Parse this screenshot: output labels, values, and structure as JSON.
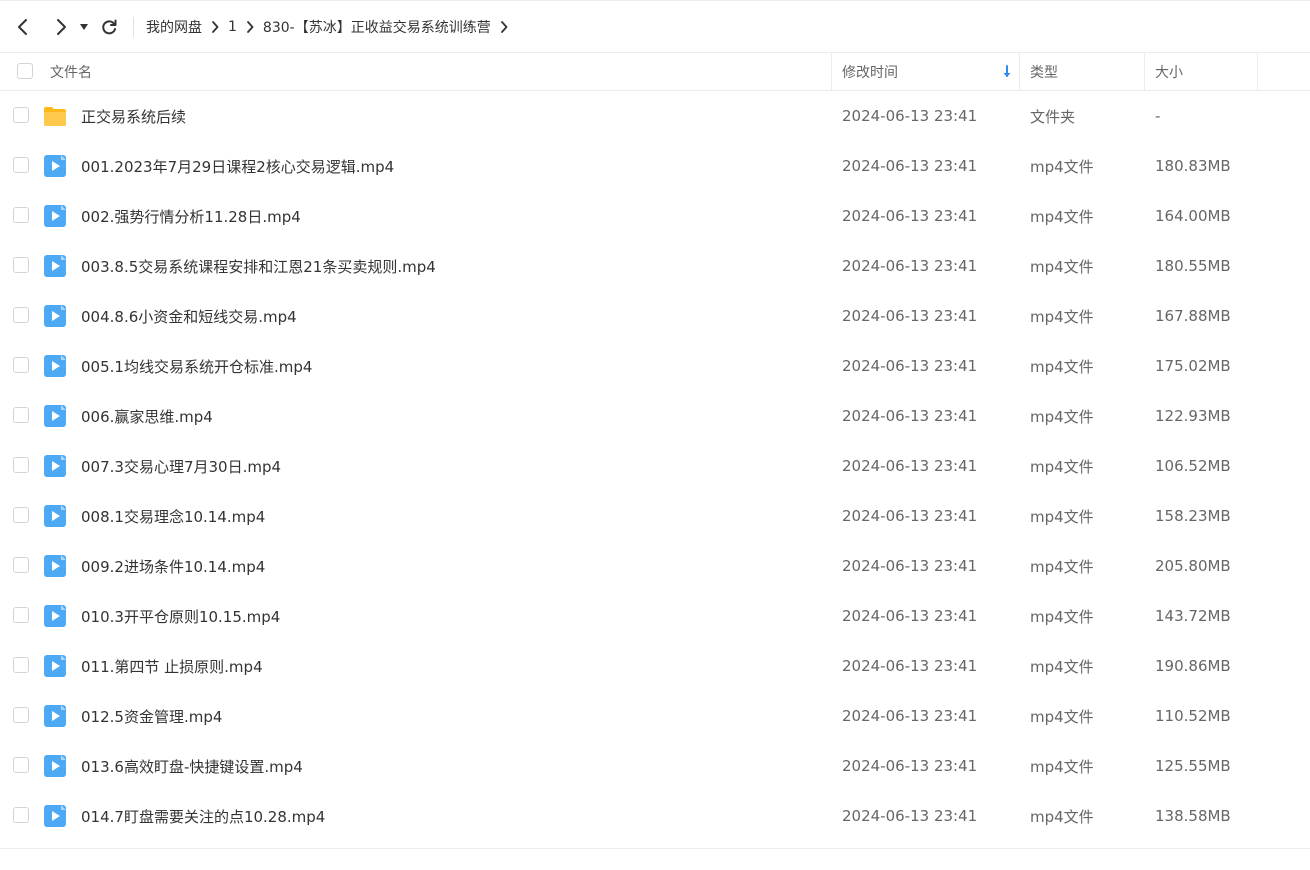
{
  "breadcrumb": [
    {
      "label": "我的网盘"
    },
    {
      "label": "1"
    },
    {
      "label": "830-【苏冰】正收益交易系统训练营"
    }
  ],
  "columns": {
    "name": "文件名",
    "modified": "修改时间",
    "type": "类型",
    "size": "大小",
    "sort_column": "modified",
    "sort_direction": "desc"
  },
  "colors": {
    "accent": "#2d8cf0",
    "folder": "#ffc53d",
    "video": "#4ea9f5"
  },
  "files": [
    {
      "name": "正交易系统后续",
      "modified": "2024-06-13 23:41",
      "type": "文件夹",
      "size": "-",
      "icon": "folder-icon"
    },
    {
      "name": "001.2023年7月29日课程2核心交易逻辑.mp4",
      "modified": "2024-06-13 23:41",
      "type": "mp4文件",
      "size": "180.83MB",
      "icon": "video-file-icon"
    },
    {
      "name": "002.强势行情分析11.28日.mp4",
      "modified": "2024-06-13 23:41",
      "type": "mp4文件",
      "size": "164.00MB",
      "icon": "video-file-icon"
    },
    {
      "name": "003.8.5交易系统课程安排和江恩21条买卖规则.mp4",
      "modified": "2024-06-13 23:41",
      "type": "mp4文件",
      "size": "180.55MB",
      "icon": "video-file-icon"
    },
    {
      "name": "004.8.6小资金和短线交易.mp4",
      "modified": "2024-06-13 23:41",
      "type": "mp4文件",
      "size": "167.88MB",
      "icon": "video-file-icon"
    },
    {
      "name": "005.1均线交易系统开仓标准.mp4",
      "modified": "2024-06-13 23:41",
      "type": "mp4文件",
      "size": "175.02MB",
      "icon": "video-file-icon"
    },
    {
      "name": "006.赢家思维.mp4",
      "modified": "2024-06-13 23:41",
      "type": "mp4文件",
      "size": "122.93MB",
      "icon": "video-file-icon"
    },
    {
      "name": "007.3交易心理7月30日.mp4",
      "modified": "2024-06-13 23:41",
      "type": "mp4文件",
      "size": "106.52MB",
      "icon": "video-file-icon"
    },
    {
      "name": "008.1交易理念10.14.mp4",
      "modified": "2024-06-13 23:41",
      "type": "mp4文件",
      "size": "158.23MB",
      "icon": "video-file-icon"
    },
    {
      "name": "009.2进场条件10.14.mp4",
      "modified": "2024-06-13 23:41",
      "type": "mp4文件",
      "size": "205.80MB",
      "icon": "video-file-icon"
    },
    {
      "name": "010.3开平仓原则10.15.mp4",
      "modified": "2024-06-13 23:41",
      "type": "mp4文件",
      "size": "143.72MB",
      "icon": "video-file-icon"
    },
    {
      "name": "011.第四节 止损原则.mp4",
      "modified": "2024-06-13 23:41",
      "type": "mp4文件",
      "size": "190.86MB",
      "icon": "video-file-icon"
    },
    {
      "name": "012.5资金管理.mp4",
      "modified": "2024-06-13 23:41",
      "type": "mp4文件",
      "size": "110.52MB",
      "icon": "video-file-icon"
    },
    {
      "name": "013.6高效盯盘-快捷键设置.mp4",
      "modified": "2024-06-13 23:41",
      "type": "mp4文件",
      "size": "125.55MB",
      "icon": "video-file-icon"
    },
    {
      "name": "014.7盯盘需要关注的点10.28.mp4",
      "modified": "2024-06-13 23:41",
      "type": "mp4文件",
      "size": "138.58MB",
      "icon": "video-file-icon"
    }
  ]
}
